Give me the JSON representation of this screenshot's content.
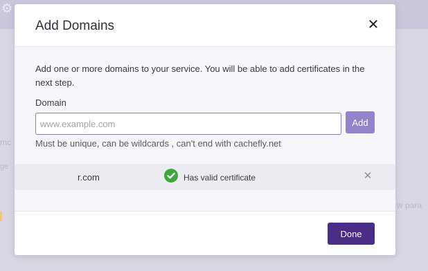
{
  "background": {
    "fragment_left_a": "mc",
    "fragment_left_b": "ge",
    "fragment_right": "w para",
    "gear_icon": "gear-icon"
  },
  "dialog": {
    "title": "Add Domains",
    "close_icon": "close-icon",
    "description": "Add one or more domains to your service. You will be able to add certificates in the next step.",
    "field_label": "Domain",
    "input": {
      "value": "",
      "placeholder": "www.example.com"
    },
    "add_label": "Add",
    "hint": "Must be unique, can be wildcards , can't end with cachefly.net",
    "domains": [
      {
        "name": "r.com",
        "status": "Has valid certificate",
        "status_icon": "check-circle-icon",
        "status_color": "#3ea63a"
      }
    ],
    "done_label": "Done"
  },
  "colors": {
    "accent": "#9583c9",
    "primary": "#4a2d86",
    "input_border": "#8d7cc6"
  }
}
